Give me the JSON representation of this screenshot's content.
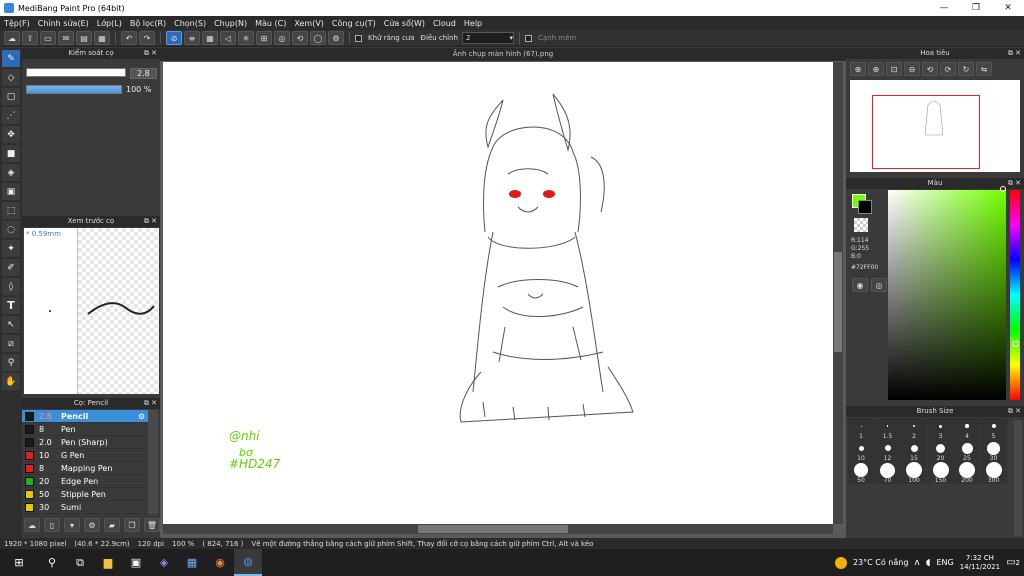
{
  "window": {
    "title": "MediBang Paint Pro (64bit)",
    "minimize": "—",
    "maximize": "❐",
    "close": "✕"
  },
  "menu": [
    "Tệp(F)",
    "Chỉnh sửa(E)",
    "Lớp(L)",
    "Bộ lọc(R)",
    "Chọn(S)",
    "Chụp(N)",
    "Màu (C)",
    "Xem(V)",
    "Công cụ(T)",
    "Cửa sổ(W)",
    "Cloud",
    "Help"
  ],
  "toolbar": {
    "antialias_label": "Khử răng cưa",
    "adjust_label": "Điều chỉnh",
    "adjust_value": "2",
    "soft_label": "Cạnh mềm"
  },
  "panels": {
    "brush_control": {
      "title": "Kiểm soát cọ",
      "size_value": "2.8",
      "opacity_value": "100 %"
    },
    "brush_preview": {
      "title": "Xem trước cọ",
      "size_mm": "* 0.59mm"
    },
    "brush_list": {
      "title": "Cọ: Pencil",
      "items": [
        {
          "size": "2.8",
          "name": "Pencil",
          "color": "#1a1a1a",
          "selected": true
        },
        {
          "size": "8",
          "name": "Pen",
          "color": "#1a1a1a",
          "selected": false
        },
        {
          "size": "2.0",
          "name": "Pen (Sharp)",
          "color": "#1a1a1a",
          "selected": false
        },
        {
          "size": "10",
          "name": "G Pen",
          "color": "#e02020",
          "selected": false
        },
        {
          "size": "8",
          "name": "Mapping Pen",
          "color": "#e02020",
          "selected": false
        },
        {
          "size": "20",
          "name": "Edge Pen",
          "color": "#20b020",
          "selected": false
        },
        {
          "size": "50",
          "name": "Stipple Pen",
          "color": "#e8c800",
          "selected": false
        },
        {
          "size": "30",
          "name": "Sumi",
          "color": "#e8c800",
          "selected": false
        }
      ]
    },
    "navigator": {
      "title": "Hoa tiêu"
    },
    "color": {
      "title": "Màu",
      "r": "R:114",
      "g": "G:255",
      "b": "B:0",
      "hex": "#72FF00",
      "fg": "#72ff00"
    },
    "brush_size": {
      "title": "Brush Size",
      "sizes": [
        "1",
        "1.5",
        "2",
        "3",
        "4",
        "5",
        "10",
        "12",
        "15",
        "20",
        "25",
        "30",
        "50",
        "70",
        "100",
        "150",
        "200",
        "300"
      ]
    }
  },
  "document": {
    "tab": "Ảnh chụp màn hình (67).png",
    "signature": [
      "@nhi",
      "bơ",
      "#HD247"
    ]
  },
  "status": {
    "size": "1920 * 1080 pixel",
    "cm": "(40.6 * 22.9cm)",
    "dpi": "120 dpi",
    "zoom": "100 %",
    "coords": "( 824, 716 )",
    "hint": "Vẽ một đường thẳng bằng cách giữ phím Shift, Thay đổi cỡ cọ bằng cách giữ phím Ctrl, Alt và kéo"
  },
  "taskbar": {
    "weather": "23°C Có nắng",
    "lang": "ENG",
    "time": "7:32 CH",
    "date": "14/11/2021",
    "notif": "2"
  }
}
